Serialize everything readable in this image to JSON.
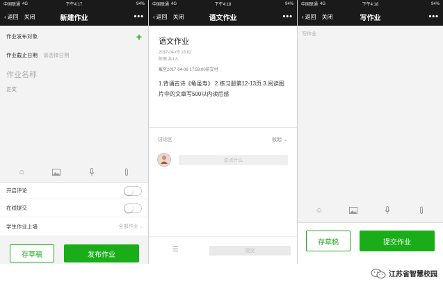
{
  "status_bars": [
    {
      "carrier": "中国联通",
      "network": "4G",
      "time": "下午4:17",
      "battery": "94%"
    },
    {
      "carrier": "中国联通",
      "network": "4G",
      "time": "下午4:18",
      "battery": "94%"
    },
    {
      "carrier": "中国联通",
      "network": "4G",
      "time": "下午4:18",
      "battery": "94%"
    }
  ],
  "nav": {
    "back_label": "返回",
    "close_label": "关闭",
    "more_label": "•••"
  },
  "screen1": {
    "title": "新建作业",
    "publish_target_label": "作业发布对象",
    "add_icon": "plus-icon",
    "deadline_label": "作业截止日期",
    "deadline_placeholder": "请选择日期",
    "name_placeholder": "作业名称",
    "body_placeholder": "正文",
    "toolbar_icons": [
      "emoji-icon",
      "image-icon",
      "microphone-icon",
      "attachment-icon"
    ],
    "enable_comments_label": "开启评论",
    "online_submit_label": "在线提交",
    "wall_label": "学生作业上墙",
    "wall_value": "全部作业",
    "draft_button": "存草稿",
    "publish_button": "发布作业"
  },
  "screen2": {
    "title": "语文作业",
    "hw_title": "语文作业",
    "date": "2017-04-05 18:02",
    "author": "陈莺 共1人",
    "deadline": "截至2017-04-06 17:59:00前交付",
    "content": "1.背诵古诗《龟虽寿》 2.练习册第12-13页 3.阅读图片中的文章写500以内读后感",
    "discussion_label": "讨论区",
    "collapse_label": "收起",
    "comment_placeholder": "说点什么",
    "submit_label": "提交"
  },
  "screen3": {
    "title": "写作业",
    "body_placeholder": "写作业",
    "toolbar_icons": [
      "emoji-icon",
      "image-icon",
      "microphone-icon",
      "attachment-icon"
    ],
    "draft_button": "存草稿",
    "submit_button": "提交作业"
  },
  "watermark": {
    "text": "江苏省智慧校园"
  },
  "colors": {
    "accent": "#1aad19",
    "nav_bg": "#1a1a1a"
  }
}
